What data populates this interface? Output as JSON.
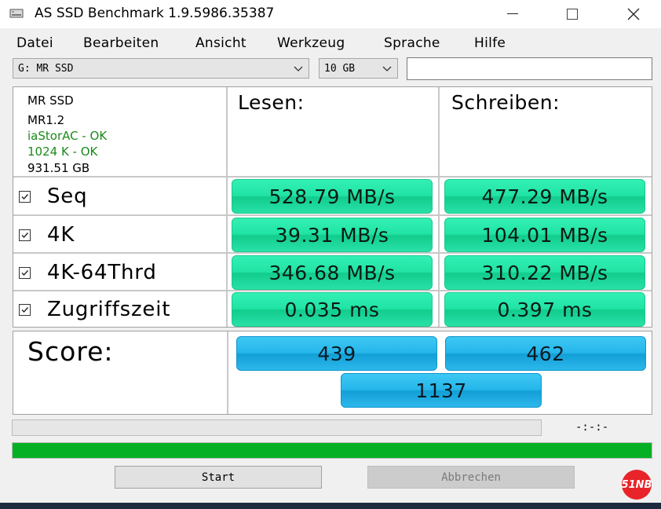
{
  "window": {
    "title": "AS SSD Benchmark 1.9.5986.35387",
    "controls": {
      "minimize": "—",
      "maximize": "☐",
      "close": "✕"
    }
  },
  "menu": [
    "Datei",
    "Bearbeiten",
    "Ansicht",
    "Werkzeug",
    "Sprache",
    "Hilfe"
  ],
  "drive_select": {
    "value": "G: MR SSD"
  },
  "size_select": {
    "value": "10 GB"
  },
  "drive_info": {
    "model": "MR SSD",
    "firmware": "MR1.2",
    "driver": "iaStorAC - OK",
    "alignment": "1024 K - OK",
    "capacity": "931.51 GB",
    "ok_color": "#1a8a1a"
  },
  "columns": {
    "read": "Lesen:",
    "write": "Schreiben:"
  },
  "tests": [
    {
      "label": "Seq",
      "checked": true,
      "read": "528.79 MB/s",
      "write": "477.29 MB/s"
    },
    {
      "label": "4K",
      "checked": true,
      "read": "39.31 MB/s",
      "write": "104.01 MB/s"
    },
    {
      "label": "4K-64Thrd",
      "checked": true,
      "read": "346.68 MB/s",
      "write": "310.22 MB/s"
    },
    {
      "label": "Zugriffszeit",
      "checked": true,
      "read": "0.035 ms",
      "write": "0.397 ms"
    }
  ],
  "score": {
    "label": "Score:",
    "read": "439",
    "write": "462",
    "total": "1137"
  },
  "progress": {
    "time": "-:-:-",
    "fraction": 1.0,
    "color": "#06b025"
  },
  "buttons": {
    "start": "Start",
    "abort": "Abbrechen"
  },
  "watermark": "51NB",
  "colors": {
    "result_green": "#20e3a4",
    "score_blue": "#25b6ea"
  }
}
